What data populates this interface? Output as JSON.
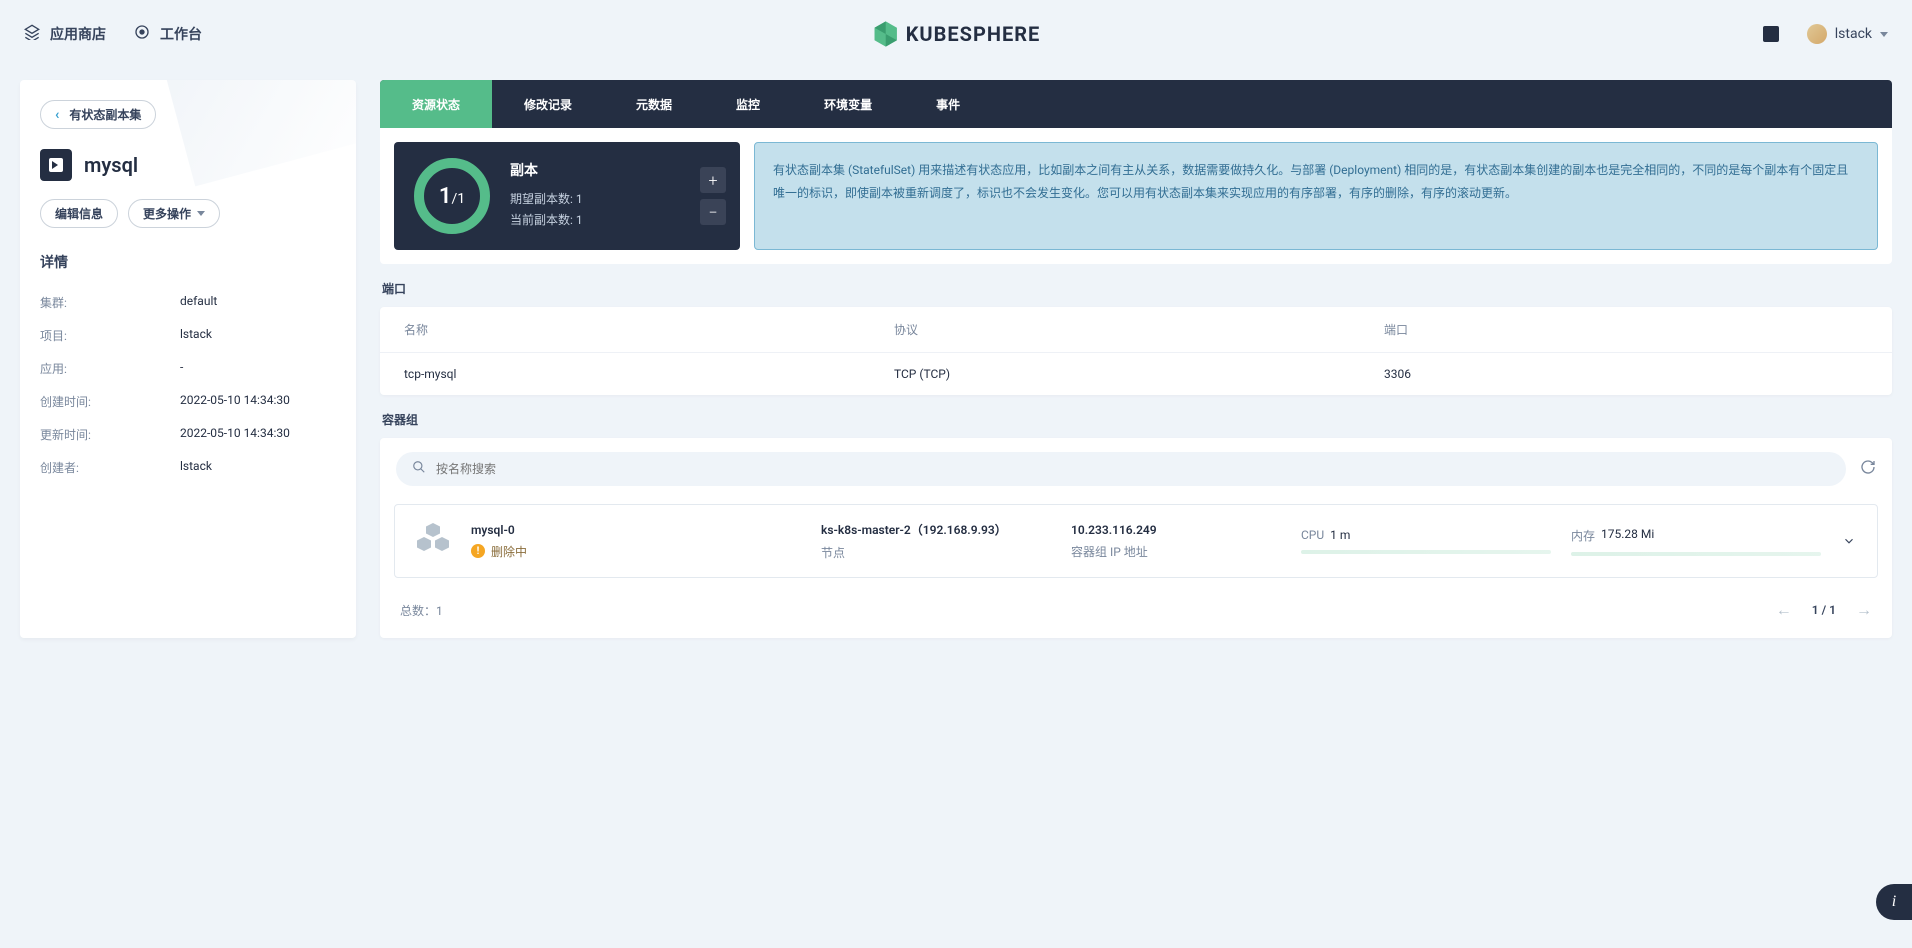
{
  "header": {
    "appStore": "应用商店",
    "workbench": "工作台",
    "logoText": "KUBESPHERE",
    "username": "lstack"
  },
  "sidebar": {
    "backLabel": "有状态副本集",
    "title": "mysql",
    "editBtn": "编辑信息",
    "moreBtn": "更多操作",
    "detailsTitle": "详情",
    "details": [
      {
        "label": "集群:",
        "value": "default"
      },
      {
        "label": "项目:",
        "value": "lstack"
      },
      {
        "label": "应用:",
        "value": "-"
      },
      {
        "label": "创建时间:",
        "value": "2022-05-10 14:34:30"
      },
      {
        "label": "更新时间:",
        "value": "2022-05-10 14:34:30"
      },
      {
        "label": "创建者:",
        "value": "lstack"
      }
    ]
  },
  "tabs": [
    {
      "label": "资源状态",
      "active": true
    },
    {
      "label": "修改记录",
      "active": false
    },
    {
      "label": "元数据",
      "active": false
    },
    {
      "label": "监控",
      "active": false
    },
    {
      "label": "环境变量",
      "active": false
    },
    {
      "label": "事件",
      "active": false
    }
  ],
  "replica": {
    "current": "1",
    "sep": "/",
    "total": "1",
    "title": "副本",
    "desired": "期望副本数: 1",
    "actual": "当前副本数: 1"
  },
  "infoBox": "有状态副本集 (StatefulSet) 用来描述有状态应用，比如副本之间有主从关系，数据需要做持久化。与部署 (Deployment) 相同的是，有状态副本集创建的副本也是完全相同的，不同的是每个副本有个固定且唯一的标识，即使副本被重新调度了，标识也不会发生变化。您可以用有状态副本集来实现应用的有序部署，有序的删除，有序的滚动更新。",
  "ports": {
    "title": "端口",
    "cols": {
      "name": "名称",
      "proto": "协议",
      "port": "端口"
    },
    "rows": [
      {
        "name": "tcp-mysql",
        "proto": "TCP (TCP)",
        "port": "3306"
      }
    ]
  },
  "pods": {
    "title": "容器组",
    "searchPlaceholder": "按名称搜索",
    "items": [
      {
        "name": "mysql-0",
        "status": "删除中",
        "node": "ks-k8s-master-2（192.168.9.93）",
        "nodeLabel": "节点",
        "ip": "10.233.116.249",
        "ipLabel": "容器组 IP 地址",
        "cpuLabel": "CPU",
        "cpuVal": "1 m",
        "memLabel": "内存",
        "memVal": "175.28 Mi"
      }
    ],
    "totalLabel": "总数：",
    "totalValue": "1",
    "page": "1 / 1"
  }
}
